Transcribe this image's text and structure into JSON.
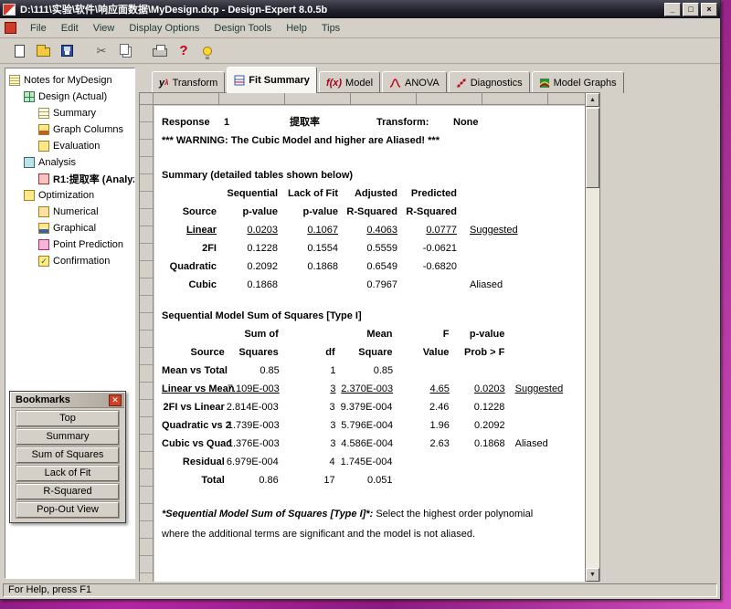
{
  "window": {
    "title": "D:\\111\\实验\\软件\\响应面数据\\MyDesign.dxp - Design-Expert 8.0.5b",
    "controls": {
      "minimize": "_",
      "maximize": "□",
      "close": "×"
    },
    "status": "For Help, press F1"
  },
  "menu": {
    "items": [
      {
        "label": "File"
      },
      {
        "label": "Edit"
      },
      {
        "label": "View"
      },
      {
        "label": "Display Options"
      },
      {
        "label": "Design Tools"
      },
      {
        "label": "Help"
      },
      {
        "label": "Tips"
      }
    ]
  },
  "toolbar": {
    "buttons": [
      "new-document-icon",
      "open-icon",
      "save-icon",
      "cut-icon",
      "copy-icon",
      "print-icon",
      "help-icon",
      "tips-bulb-icon"
    ]
  },
  "tree": {
    "items": [
      {
        "label": "Notes for MyDesign",
        "level": 0,
        "icon": "notes-icon"
      },
      {
        "label": "Design (Actual)",
        "level": 1,
        "icon": "design-icon"
      },
      {
        "label": "Summary",
        "level": 2,
        "icon": "summary-icon"
      },
      {
        "label": "Graph Columns",
        "level": 2,
        "icon": "graph-columns-icon"
      },
      {
        "label": "Evaluation",
        "level": 2,
        "icon": "evaluation-icon"
      },
      {
        "label": "Analysis",
        "level": 1,
        "icon": "analysis-icon"
      },
      {
        "label": "R1:提取率 (Analyz",
        "level": 2,
        "icon": "response-icon",
        "bold": true
      },
      {
        "label": "Optimization",
        "level": 1,
        "icon": "optimization-icon"
      },
      {
        "label": "Numerical",
        "level": 2,
        "icon": "numerical-icon"
      },
      {
        "label": "Graphical",
        "level": 2,
        "icon": "graphical-icon"
      },
      {
        "label": "Point Prediction",
        "level": 2,
        "icon": "point-prediction-icon"
      },
      {
        "label": "Confirmation",
        "level": 2,
        "icon": "confirmation-icon"
      }
    ]
  },
  "tabs": [
    {
      "label": "Transform",
      "icon": "transform-icon",
      "icon_glyph": "yλ"
    },
    {
      "label": "Fit Summary",
      "icon": "fit-summary-icon",
      "selected": true
    },
    {
      "label": "Model",
      "icon": "model-icon",
      "icon_glyph": "f(x)"
    },
    {
      "label": "ANOVA",
      "icon": "anova-icon"
    },
    {
      "label": "Diagnostics",
      "icon": "diagnostics-icon"
    },
    {
      "label": "Model Graphs",
      "icon": "model-graphs-icon"
    }
  ],
  "report": {
    "response_label": "Response",
    "response_number": "1",
    "response_name": "提取率",
    "transform_label": "Transform:",
    "transform_value": "None",
    "warning": "*** WARNING:  The Cubic Model and higher are Aliased! ***",
    "summary": {
      "title": "Summary (detailed tables shown below)",
      "headers": [
        {
          "cells": [
            "",
            "Sequential",
            "Lack of Fit",
            "Adjusted",
            "Predicted",
            ""
          ]
        },
        {
          "cells": [
            "Source",
            "p-value",
            "p-value",
            "R-Squared",
            "R-Squared",
            ""
          ]
        }
      ],
      "rows": [
        {
          "cells": [
            "Linear",
            "0.0203",
            "0.1067",
            "0.4063",
            "0.0777",
            "Suggested"
          ],
          "underline": true
        },
        {
          "cells": [
            "2FI",
            "0.1228",
            "0.1554",
            "0.5559",
            "-0.0621",
            ""
          ]
        },
        {
          "cells": [
            "Quadratic",
            "0.2092",
            "0.1868",
            "0.6549",
            "-0.6820",
            ""
          ]
        },
        {
          "cells": [
            "Cubic",
            "0.1868",
            "",
            "0.7967",
            "",
            "Aliased"
          ]
        }
      ]
    },
    "sequential": {
      "title": "Sequential Model Sum of Squares [Type I]",
      "headers": [
        {
          "cells": [
            "",
            "Sum of",
            "",
            "Mean",
            "F",
            "p-value",
            ""
          ]
        },
        {
          "cells": [
            "Source",
            "Squares",
            "df",
            "Square",
            "Value",
            "Prob > F",
            ""
          ]
        }
      ],
      "rows": [
        {
          "cells": [
            "Mean vs Total",
            "0.85",
            "1",
            "0.85",
            "",
            "",
            ""
          ]
        },
        {
          "cells": [
            "Linear vs Mean",
            "7.109E-003",
            "3",
            "2.370E-003",
            "4.65",
            "0.0203",
            "Suggested"
          ],
          "underline": true
        },
        {
          "cells": [
            "2FI vs Linear",
            "2.814E-003",
            "3",
            "9.379E-004",
            "2.46",
            "0.1228",
            ""
          ]
        },
        {
          "cells": [
            "Quadratic vs 2",
            "1.739E-003",
            "3",
            "5.796E-004",
            "1.96",
            "0.2092",
            ""
          ]
        },
        {
          "cells": [
            "Cubic vs Quad",
            "1.376E-003",
            "3",
            "4.586E-004",
            "2.63",
            "0.1868",
            "Aliased"
          ]
        },
        {
          "cells": [
            "Residual",
            "6.979E-004",
            "4",
            "1.745E-004",
            "",
            "",
            ""
          ]
        },
        {
          "cells": [
            "Total",
            "0.86",
            "17",
            "0.051",
            "",
            "",
            ""
          ]
        }
      ]
    },
    "footnote_em": "*Sequential Model Sum of Squares [Type I]*:",
    "footnote_text": "Select the highest order polynomial where the additional terms are significant and the model is not aliased."
  },
  "bookmarks": {
    "title": "Bookmarks",
    "buttons": [
      {
        "label": "Top"
      },
      {
        "label": "Summary"
      },
      {
        "label": "Sum of Squares"
      },
      {
        "label": "Lack of Fit"
      },
      {
        "label": "R-Squared"
      },
      {
        "label": "Pop-Out View"
      }
    ]
  }
}
